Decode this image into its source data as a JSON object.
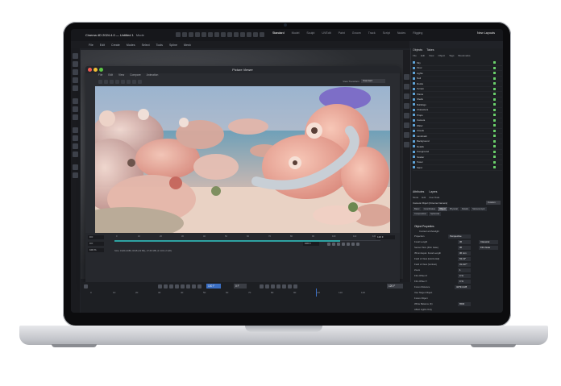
{
  "app": {
    "window_title": "Cinema 4D 2024.4.0 — Untitled 1",
    "menubar_left": "CINEMA 4D",
    "mode_label": "Mode",
    "layouts": [
      "Standard",
      "Model",
      "Sculpt",
      "UVEdit",
      "Paint",
      "Groom",
      "Track",
      "Script",
      "Nodes",
      "Rigging"
    ],
    "active_layout": "Standard",
    "new_layouts": "New Layouts",
    "menus": [
      "File",
      "Edit",
      "Create",
      "Modes",
      "Select",
      "Tools",
      "Spline",
      "Mesh",
      "Volume",
      "MoGraph",
      "Character",
      "Animate",
      "Simulate",
      "Tracker",
      "Render",
      "Extensions",
      "Window",
      "Help"
    ]
  },
  "picture_viewer": {
    "title": "Picture Viewer",
    "menus": [
      "File",
      "Edit",
      "View",
      "Compare",
      "Animation"
    ],
    "view_transform_label": "View Transform",
    "view_transform_value": "Standard",
    "frame_field": "0 F",
    "frame_field2": "0 F",
    "zoom": "100 %",
    "end_frame": "120 F",
    "current_frame": "100 F",
    "status_text": "Size: 1920x1080, RGB (32 Bit), 27.66 MB, (F 100 of 120)",
    "ticks": [
      "0",
      "10",
      "20",
      "30",
      "40",
      "50",
      "60",
      "70",
      "80",
      "90",
      "100",
      "110",
      "120"
    ]
  },
  "timeline": {
    "numbers": [
      "0",
      "10",
      "20",
      "30",
      "40",
      "50",
      "60",
      "70",
      "80",
      "90",
      "100",
      "110",
      "120"
    ],
    "fields": [
      "0 F",
      "120 F",
      "100 F"
    ],
    "active_field": "100 F"
  },
  "objects_panel": {
    "tabs": [
      "Objects",
      "Takes"
    ],
    "menu": [
      "File",
      "Edit",
      "View",
      "Object",
      "Tags",
      "Bookmarks"
    ],
    "items": [
      "Sky",
      "Floor",
      "Lights",
      "Null",
      "Rocks",
      "Terrain",
      "Plants",
      "Shells",
      "Buildings",
      "Characters",
      "Props",
      "Camera",
      "Water",
      "Clouds",
      "Landmark",
      "Background",
      "Details",
      "Foreground",
      "Scatter",
      "Tower",
      "Sand"
    ],
    "attributes_tabs": [
      "Attributes",
      "Layers"
    ],
    "attributes_menu": [
      "Mode",
      "Edit",
      "User Data"
    ],
    "attributes_subtitle": "Camera Object [Cinema Camera]",
    "attributes_custom": "Custom",
    "sub_tabs": [
      "Basic",
      "Coordinates",
      "Object",
      "Physical",
      "Details",
      "Stereoscopic",
      "Composition",
      "Spherical"
    ],
    "active_sub_tab": "Object",
    "section_title": "Object Properties",
    "contact": "Contact at Metalight",
    "properties": [
      {
        "label": "Projection",
        "value": "Perspective"
      },
      {
        "label": "Focal Length",
        "value": "36"
      },
      {
        "label": "Sensor Size (Film Gate)",
        "value": "36"
      },
      {
        "label": "35mm Equiv. Focal Length",
        "value": "36 mm"
      },
      {
        "label": "Field of View (Horizontal)",
        "value": "53.13°"
      },
      {
        "label": "Field of View (Vertical)",
        "value": "31.417°"
      },
      {
        "label": "Zoom",
        "value": "1"
      },
      {
        "label": "Film Offset X",
        "value": "0 %"
      },
      {
        "label": "Film Offset Y",
        "value": "0 %"
      },
      {
        "label": "Focus Distance",
        "value": "42794.428"
      },
      {
        "label": "Use Target Object",
        "value": ""
      },
      {
        "label": "Focus Object",
        "value": ""
      },
      {
        "label": "White Balance (K)",
        "value": "6500"
      },
      {
        "label": "Affect Lights Only",
        "value": ""
      },
      {
        "label": "Export to Compositing",
        "value": ""
      }
    ],
    "secondary_values": [
      "Film Gate",
      "Classical"
    ]
  },
  "colors": {
    "accent": "#3b6fc3",
    "timeline_fill": "#2fa3a3",
    "object_icon": "#5ea4d9",
    "check": "#6ad06a"
  }
}
